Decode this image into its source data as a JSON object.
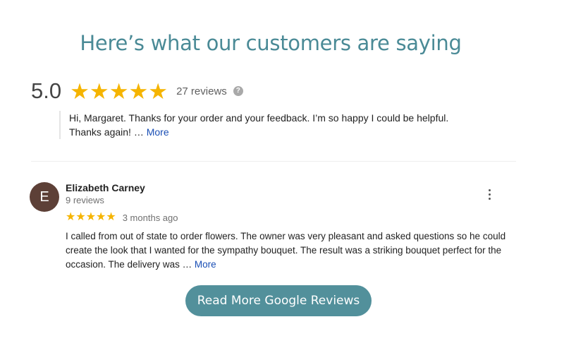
{
  "heading": "Here’s what our customers are saying",
  "summary": {
    "rating": "5.0",
    "stars": "★★★★★",
    "review_count": "27 reviews",
    "help_glyph": "?"
  },
  "owner_reply": {
    "text": "Hi, Margaret. Thanks for your order and your feedback. I’m so happy I could be helpful. Thanks again! … ",
    "more_label": "More"
  },
  "review": {
    "avatar_initial": "E",
    "reviewer_name": "Elizabeth Carney",
    "reviewer_reviews": "9 reviews",
    "stars": "★★★★★",
    "rating_value": 5,
    "date": "3 months ago",
    "text": "I called from out of state to order flowers. The owner was very pleasant and asked questions so he could create the look that I wanted for the sympathy bouquet. The result was a striking bouquet perfect for the occasion. The delivery was … ",
    "more_label": "More"
  },
  "cta": {
    "label": "Read More Google Reviews"
  },
  "colors": {
    "heading": "#4a8a96",
    "star": "#f5b400",
    "link": "#1a4fb5",
    "avatar": "#5d4037",
    "button": "#52909b"
  },
  "icons": {
    "more_menu": "more-vert-icon",
    "help": "help-icon"
  }
}
